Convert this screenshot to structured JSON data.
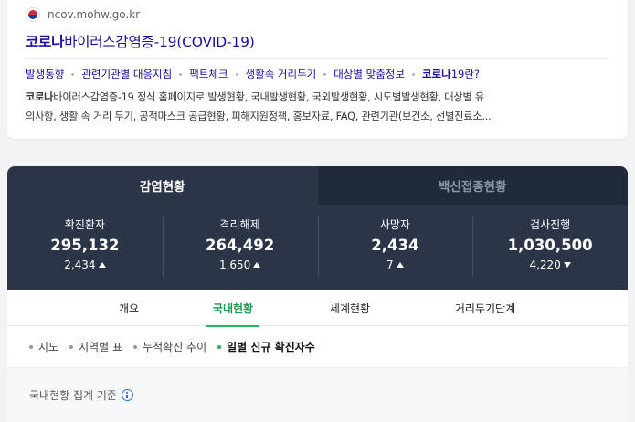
{
  "result": {
    "source_url": "ncov.mohw.go.kr",
    "source_icon": "korea-taegeuk-icon",
    "title_bold": "코로나",
    "title_rest": "바이러스감염증-19(COVID-19)",
    "sublinks": [
      "발생동향",
      "관련기관별 대응지침",
      "팩트체크",
      "생활속 거리두기",
      "대상별 맞춤정보"
    ],
    "last_sublink_bold": "코로나",
    "last_sublink_rest": "19란?",
    "snippet_bold": "코로나",
    "snippet_line1": "바이러스감염증-19 정식 홈페이지로 발생현황, 국내발생현황, 국외발생현황, 시도별발생현황, 대상별 유",
    "snippet_line2": "의사항, 생활 속 거리 두기, 공적마스크 공급현황, 피해지원정책, 홍보자료, FAQ, 관련기관(보건소, 선별진료소..."
  },
  "main_tabs": {
    "active": "감염현황",
    "inactive": "백신접종현황"
  },
  "stats": [
    {
      "label": "확진환자",
      "value": "295,132",
      "delta": "2,434",
      "direction": "up"
    },
    {
      "label": "격리해제",
      "value": "264,492",
      "delta": "1,650",
      "direction": "up"
    },
    {
      "label": "사망자",
      "value": "2,434",
      "delta": "7",
      "direction": "up"
    },
    {
      "label": "검사진행",
      "value": "1,030,500",
      "delta": "4,220",
      "direction": "down"
    }
  ],
  "sub_tabs": [
    "개요",
    "국내현황",
    "세계현황",
    "거리두기단계"
  ],
  "active_sub_tab": "국내현황",
  "filters": [
    "지도",
    "지역별 표",
    "누적확진 추이",
    "일별 신규 확진자수"
  ],
  "active_filter": "일별 신규 확진자수",
  "criteria_text": "국내현황 집계 기준",
  "colors": {
    "link": "#1a0dab",
    "panel": "#2b3547",
    "panel_dark": "#202a3a",
    "accent_green": "#1fb85b",
    "info_blue": "#2e6fd6"
  }
}
